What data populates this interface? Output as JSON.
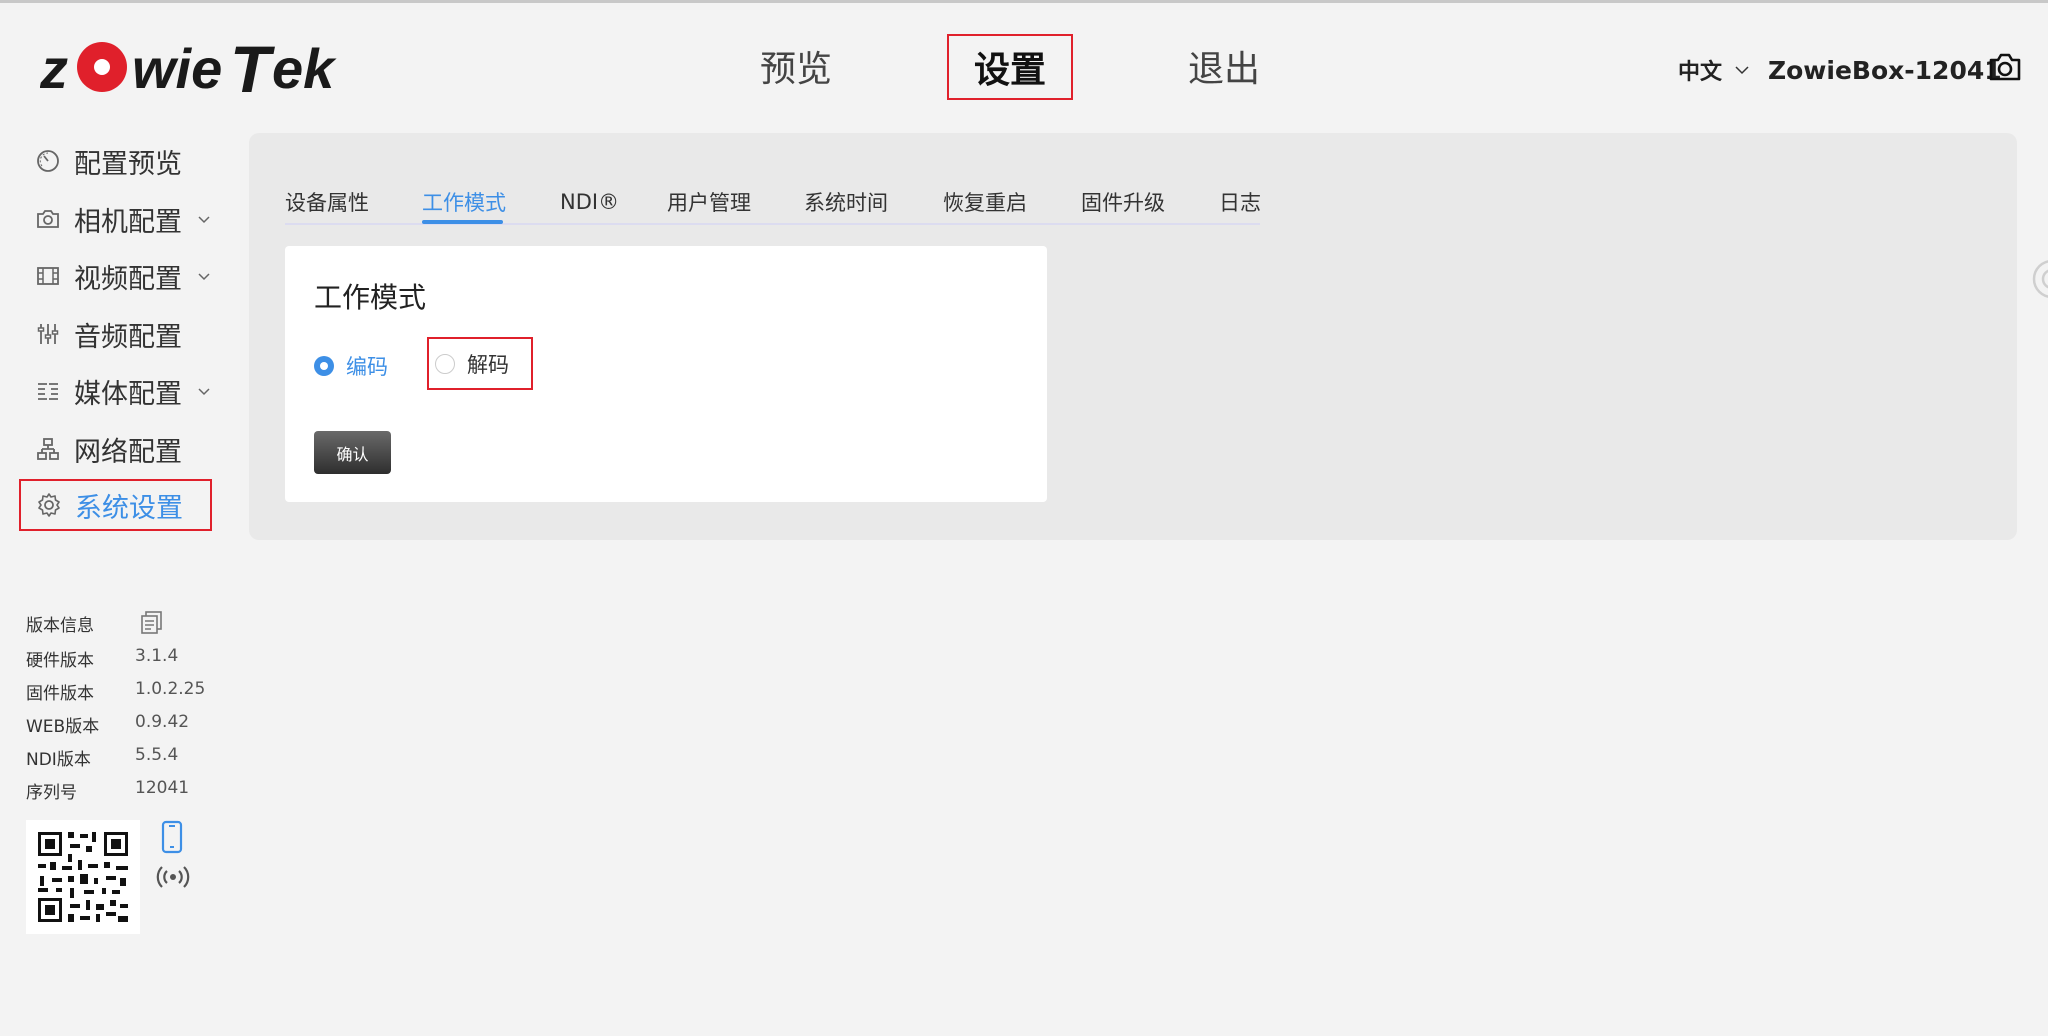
{
  "brand": {
    "logo_text": "zowieTek",
    "accent": "#e0202b"
  },
  "topnav": {
    "preview": "预览",
    "settings": "设置",
    "logout": "退出"
  },
  "header": {
    "language": "中文",
    "device_name": "ZowieBox-12041"
  },
  "sidebar": {
    "items": [
      {
        "label": "配置预览",
        "icon": "gauge-icon"
      },
      {
        "label": "相机配置",
        "icon": "camera-icon",
        "expandable": true
      },
      {
        "label": "视频配置",
        "icon": "film-icon",
        "expandable": true
      },
      {
        "label": "音频配置",
        "icon": "sliders-icon"
      },
      {
        "label": "媒体配置",
        "icon": "media-icon",
        "expandable": true
      },
      {
        "label": "网络配置",
        "icon": "network-icon"
      },
      {
        "label": "系统设置",
        "icon": "gear-icon",
        "active": true
      }
    ]
  },
  "version_info": {
    "title": "版本信息",
    "rows": [
      {
        "key": "硬件版本",
        "value": "3.1.4"
      },
      {
        "key": "固件版本",
        "value": "1.0.2.25"
      },
      {
        "key": "WEB版本",
        "value": "0.9.42"
      },
      {
        "key": "NDI版本",
        "value": "5.5.4"
      },
      {
        "key": "序列号",
        "value": "12041"
      }
    ]
  },
  "tabs": [
    {
      "label": "设备属性"
    },
    {
      "label": "工作模式",
      "active": true
    },
    {
      "label": "NDI®"
    },
    {
      "label": "用户管理"
    },
    {
      "label": "系统时间"
    },
    {
      "label": "恢复重启"
    },
    {
      "label": "固件升级"
    },
    {
      "label": "日志"
    }
  ],
  "work_mode": {
    "title": "工作模式",
    "options": [
      {
        "label": "编码",
        "selected": true
      },
      {
        "label": "解码",
        "selected": false
      }
    ],
    "confirm_label": "确认"
  },
  "colors": {
    "active_blue": "#3d8fe6",
    "highlight_red": "#e0202b"
  }
}
